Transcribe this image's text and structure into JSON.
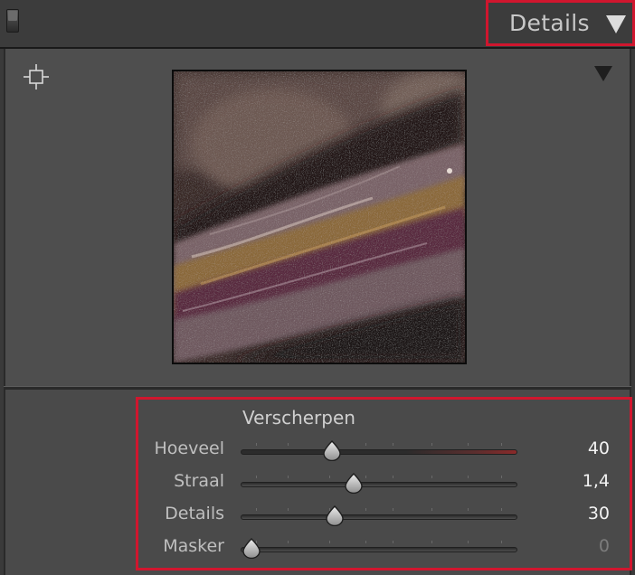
{
  "header": {
    "title": "Details",
    "collapse_icon": "triangle-down-icon",
    "switch_icon": "panel-switch-icon"
  },
  "preview": {
    "target_icon": "crosshair-target-icon",
    "menu_icon": "triangle-down-icon"
  },
  "sharpen": {
    "title": "Verscherpen",
    "sliders": [
      {
        "label": "Hoeveel",
        "value": "40",
        "fraction": 0.29,
        "enabled": true,
        "warn": true
      },
      {
        "label": "Straal",
        "value": "1,4",
        "fraction": 0.37,
        "enabled": true,
        "warn": false
      },
      {
        "label": "Details",
        "value": "30",
        "fraction": 0.3,
        "enabled": true,
        "warn": false
      },
      {
        "label": "Masker",
        "value": "0",
        "fraction": 0.0,
        "enabled": false,
        "warn": false
      }
    ]
  },
  "colors": {
    "highlight": "#d0162e",
    "panel_bg": "#4e4e4e",
    "header_bg": "#3c3c3c"
  }
}
